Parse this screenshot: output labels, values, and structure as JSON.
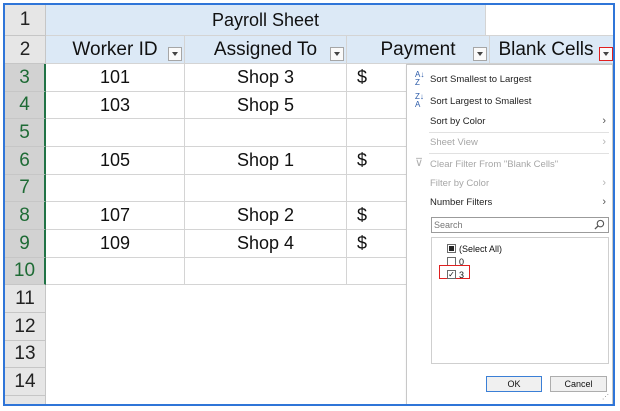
{
  "sheet": {
    "title": "Payroll Sheet",
    "headers": [
      "Worker ID",
      "Assigned To",
      "Payment",
      "Blank Cells"
    ],
    "row_numbers": [
      "1",
      "2",
      "3",
      "4",
      "5",
      "6",
      "7",
      "8",
      "9",
      "10",
      "11",
      "12",
      "13",
      "14"
    ],
    "rows": [
      {
        "row": "3",
        "worker": "101",
        "assigned": "Shop 3",
        "payment": "$"
      },
      {
        "row": "4",
        "worker": "103",
        "assigned": "Shop 5",
        "payment": ""
      },
      {
        "row": "5",
        "worker": "",
        "assigned": "",
        "payment": ""
      },
      {
        "row": "6",
        "worker": "105",
        "assigned": "Shop 1",
        "payment": "$"
      },
      {
        "row": "7",
        "worker": "",
        "assigned": "",
        "payment": ""
      },
      {
        "row": "8",
        "worker": "107",
        "assigned": "Shop 2",
        "payment": "$"
      },
      {
        "row": "9",
        "worker": "109",
        "assigned": "Shop 4",
        "payment": "$"
      },
      {
        "row": "10",
        "worker": "",
        "assigned": "",
        "payment": ""
      }
    ]
  },
  "menu": {
    "sort_asc": "Sort Smallest to Largest",
    "sort_desc": "Sort Largest to Smallest",
    "sort_color": "Sort by Color",
    "sheet_view": "Sheet View",
    "clear_filter": "Clear Filter From \"Blank Cells\"",
    "filter_color": "Filter by Color",
    "number_filters": "Number Filters",
    "search_placeholder": "Search",
    "list_items": [
      {
        "label": "(Select All)",
        "state": "partial"
      },
      {
        "label": "0",
        "state": "unchecked"
      },
      {
        "label": "3",
        "state": "checked"
      }
    ],
    "ok_label": "OK",
    "cancel_label": "Cancel"
  },
  "colors": {
    "accent": "#2f75d8",
    "header_fill": "#dce9f6",
    "highlight_red": "#e02020",
    "row_header_selected": "#1e6b35"
  }
}
